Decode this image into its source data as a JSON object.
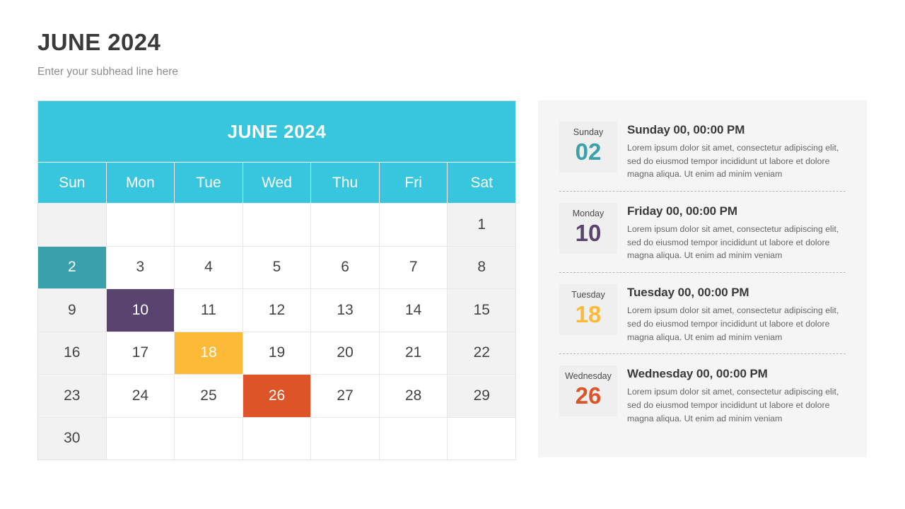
{
  "header": {
    "title": "JUNE 2024",
    "subhead": "Enter your subhead line here"
  },
  "calendar": {
    "title": "JUNE 2024",
    "weekdays": [
      "Sun",
      "Mon",
      "Tue",
      "Wed",
      "Thu",
      "Fri",
      "Sat"
    ],
    "colors": {
      "header_bg": "#38c6de",
      "weekend_bg": "#f2f2f2",
      "grid_line": "#e8e8e8",
      "teal": "#3aa0ac",
      "purple": "#5b4370",
      "amber": "#fcba38",
      "orange": "#dc5427"
    },
    "weeks": [
      [
        {
          "day": "",
          "weekend": true,
          "highlight": ""
        },
        {
          "day": "",
          "weekend": false,
          "highlight": ""
        },
        {
          "day": "",
          "weekend": false,
          "highlight": ""
        },
        {
          "day": "",
          "weekend": false,
          "highlight": ""
        },
        {
          "day": "",
          "weekend": false,
          "highlight": ""
        },
        {
          "day": "",
          "weekend": false,
          "highlight": ""
        },
        {
          "day": "1",
          "weekend": true,
          "highlight": ""
        }
      ],
      [
        {
          "day": "2",
          "weekend": true,
          "highlight": "#3aa0ac"
        },
        {
          "day": "3",
          "weekend": false,
          "highlight": ""
        },
        {
          "day": "4",
          "weekend": false,
          "highlight": ""
        },
        {
          "day": "5",
          "weekend": false,
          "highlight": ""
        },
        {
          "day": "6",
          "weekend": false,
          "highlight": ""
        },
        {
          "day": "7",
          "weekend": false,
          "highlight": ""
        },
        {
          "day": "8",
          "weekend": true,
          "highlight": ""
        }
      ],
      [
        {
          "day": "9",
          "weekend": true,
          "highlight": ""
        },
        {
          "day": "10",
          "weekend": false,
          "highlight": "#5b4370"
        },
        {
          "day": "11",
          "weekend": false,
          "highlight": ""
        },
        {
          "day": "12",
          "weekend": false,
          "highlight": ""
        },
        {
          "day": "13",
          "weekend": false,
          "highlight": ""
        },
        {
          "day": "14",
          "weekend": false,
          "highlight": ""
        },
        {
          "day": "15",
          "weekend": true,
          "highlight": ""
        }
      ],
      [
        {
          "day": "16",
          "weekend": true,
          "highlight": ""
        },
        {
          "day": "17",
          "weekend": false,
          "highlight": ""
        },
        {
          "day": "18",
          "weekend": false,
          "highlight": "#fcba38"
        },
        {
          "day": "19",
          "weekend": false,
          "highlight": ""
        },
        {
          "day": "20",
          "weekend": false,
          "highlight": ""
        },
        {
          "day": "21",
          "weekend": false,
          "highlight": ""
        },
        {
          "day": "22",
          "weekend": true,
          "highlight": ""
        }
      ],
      [
        {
          "day": "23",
          "weekend": true,
          "highlight": ""
        },
        {
          "day": "24",
          "weekend": false,
          "highlight": ""
        },
        {
          "day": "25",
          "weekend": false,
          "highlight": ""
        },
        {
          "day": "26",
          "weekend": false,
          "highlight": "#dc5427"
        },
        {
          "day": "27",
          "weekend": false,
          "highlight": ""
        },
        {
          "day": "28",
          "weekend": false,
          "highlight": ""
        },
        {
          "day": "29",
          "weekend": true,
          "highlight": ""
        }
      ],
      [
        {
          "day": "30",
          "weekend": true,
          "highlight": ""
        },
        {
          "day": "",
          "weekend": false,
          "highlight": ""
        },
        {
          "day": "",
          "weekend": false,
          "highlight": ""
        },
        {
          "day": "",
          "weekend": false,
          "highlight": ""
        },
        {
          "day": "",
          "weekend": false,
          "highlight": ""
        },
        {
          "day": "",
          "weekend": false,
          "highlight": ""
        },
        {
          "day": "",
          "weekend": false,
          "highlight": ""
        }
      ]
    ]
  },
  "events": [
    {
      "badge_weekday": "Sunday",
      "badge_day": "02",
      "day_color": "#3aa0ac",
      "title": "Sunday 00, 00:00 PM",
      "description": "Lorem ipsum dolor sit amet, consectetur  adipiscing elit, sed do eiusmod tempor incididunt ut labore et dolore magna aliqua. Ut enim ad minim veniam"
    },
    {
      "badge_weekday": "Monday",
      "badge_day": "10",
      "day_color": "#5b4370",
      "title": "Friday 00, 00:00 PM",
      "description": "Lorem ipsum dolor sit amet, consectetur  adipiscing elit, sed do eiusmod tempor incididunt ut labore et dolore magna aliqua. Ut enim ad minim veniam"
    },
    {
      "badge_weekday": "Tuesday",
      "badge_day": "18",
      "day_color": "#fcba38",
      "title": "Tuesday 00, 00:00 PM",
      "description": "Lorem ipsum dolor sit amet, consectetur  adipiscing elit, sed do eiusmod tempor incididunt ut labore et dolore magna aliqua. Ut enim ad minim veniam"
    },
    {
      "badge_weekday": "Wednesday",
      "badge_day": "26",
      "day_color": "#dc5427",
      "title": "Wednesday 00, 00:00 PM",
      "description": "Lorem ipsum dolor sit amet, consectetur  adipiscing elit, sed do eiusmod tempor incididunt ut labore et dolore magna aliqua. Ut enim ad minim veniam"
    }
  ]
}
